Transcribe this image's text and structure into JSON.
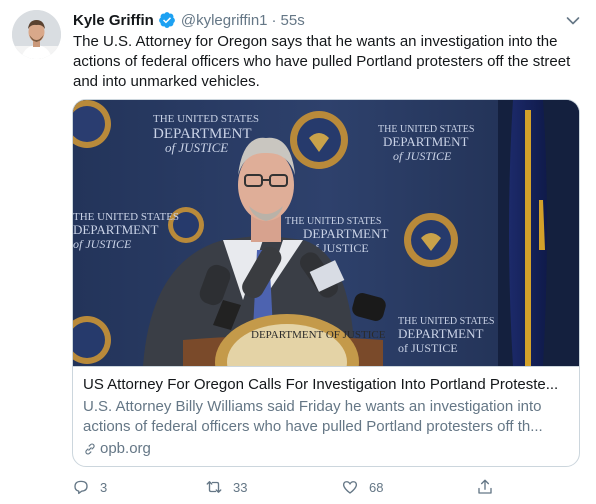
{
  "tweet": {
    "author_name": "Kyle Griffin",
    "handle": "@kylegriffin1",
    "separator": "·",
    "time": "55s",
    "text": "The U.S. Attorney for Oregon says that he wants an investigation into the actions of federal officers who have pulled Portland protesters off the street and into unmarked vehicles."
  },
  "card": {
    "title": "US Attorney For Oregon Calls For Investigation Into Portland Proteste...",
    "description": "U.S. Attorney Billy Williams said Friday he wants an investigation into actions of federal officers who have pulled Portland protesters off th...",
    "domain": "opb.org",
    "image_text": {
      "banner_line1": "THE UNITED STATES",
      "banner_line2": "DEPARTMENT",
      "banner_line3": "of JUSTICE",
      "podium_seal": "DEPARTMENT OF JUSTICE"
    }
  },
  "actions": {
    "reply_count": "3",
    "retweet_count": "33",
    "like_count": "68"
  },
  "colors": {
    "verified": "#1da1f2",
    "secondary_text": "#657786",
    "border": "#ccd6dd",
    "backdrop": "#2a3b63"
  },
  "icons": [
    "verified-badge-icon",
    "caret-down-icon",
    "link-icon",
    "reply-icon",
    "retweet-icon",
    "like-icon",
    "share-icon"
  ]
}
